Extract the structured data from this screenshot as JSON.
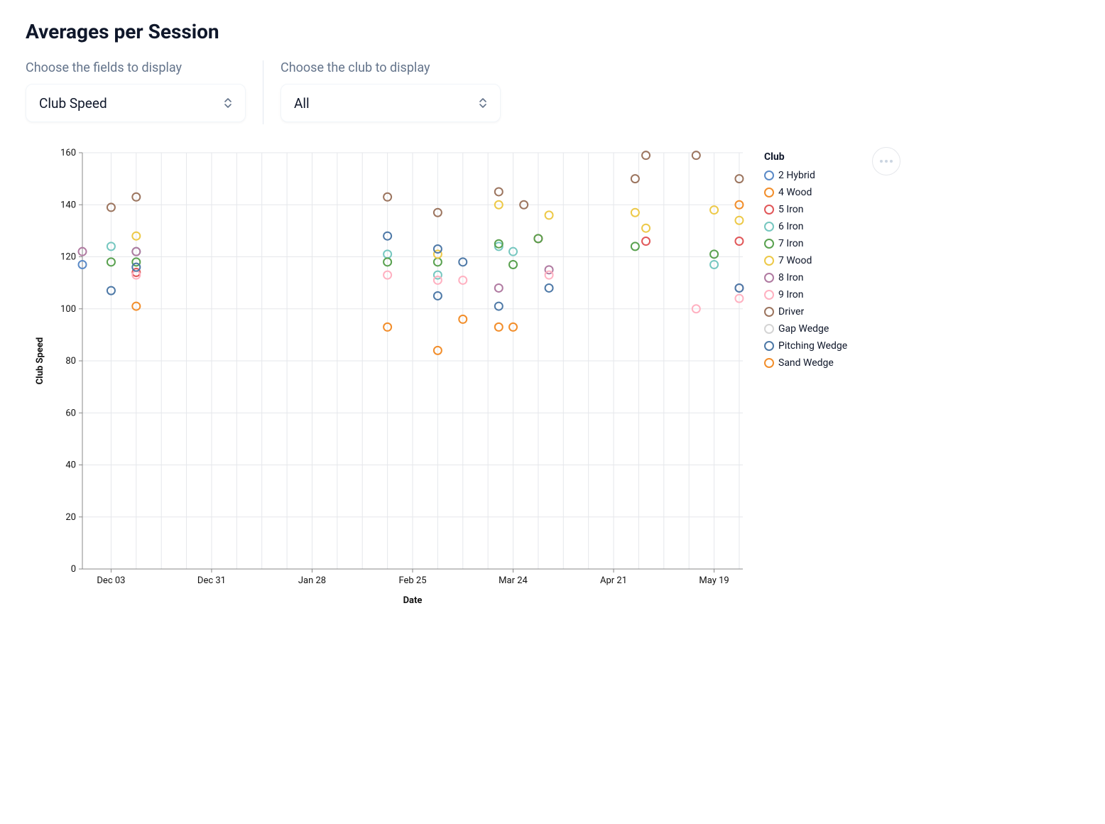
{
  "title": "Averages per Session",
  "controls": {
    "fields_label": "Choose the fields to display",
    "fields_value": "Club Speed",
    "club_label": "Choose the club to display",
    "club_value": "All"
  },
  "chart_data": {
    "type": "scatter",
    "title": "",
    "xlabel": "Date",
    "ylabel": "Club Speed",
    "ylim": [
      0,
      160
    ],
    "y_ticks": [
      0,
      20,
      40,
      60,
      80,
      100,
      120,
      140,
      160
    ],
    "x_ticks": [
      {
        "label": "Dec 03",
        "t": 0
      },
      {
        "label": "Dec 31",
        "t": 28
      },
      {
        "label": "Jan 28",
        "t": 56
      },
      {
        "label": "Feb 25",
        "t": 84
      },
      {
        "label": "Mar 24",
        "t": 112
      },
      {
        "label": "Apr 21",
        "t": 140
      },
      {
        "label": "May 19",
        "t": 168
      }
    ],
    "x_gridlines": [
      0,
      7,
      14,
      21,
      28,
      35,
      42,
      49,
      56,
      63,
      70,
      77,
      84,
      91,
      98,
      105,
      112,
      119,
      126,
      133,
      140,
      147,
      154,
      161,
      168,
      175
    ],
    "x_range": [
      -8,
      176
    ],
    "legend_title": "Club",
    "series": [
      {
        "name": "2 Hybrid",
        "color": "#5b8ac7",
        "points": [
          {
            "t": -8,
            "y": 117
          }
        ]
      },
      {
        "name": "4 Wood",
        "color": "#f28e2b",
        "points": [
          {
            "t": 7,
            "y": 101
          },
          {
            "t": 77,
            "y": 93
          },
          {
            "t": 91,
            "y": 84
          },
          {
            "t": 98,
            "y": 96
          },
          {
            "t": 108,
            "y": 93
          },
          {
            "t": 112,
            "y": 93
          }
        ]
      },
      {
        "name": "5 Iron",
        "color": "#e15759",
        "points": [
          {
            "t": 7,
            "y": 114
          },
          {
            "t": 119,
            "y": 127
          },
          {
            "t": 149,
            "y": 126
          },
          {
            "t": 175,
            "y": 126
          }
        ]
      },
      {
        "name": "6 Iron",
        "color": "#76c7c0",
        "points": [
          {
            "t": 0,
            "y": 124
          },
          {
            "t": 7,
            "y": 122
          },
          {
            "t": 77,
            "y": 121
          },
          {
            "t": 91,
            "y": 113
          },
          {
            "t": 108,
            "y": 124
          },
          {
            "t": 112,
            "y": 122
          },
          {
            "t": 168,
            "y": 117
          }
        ]
      },
      {
        "name": "7 Iron",
        "color": "#59a14f",
        "points": [
          {
            "t": 0,
            "y": 118
          },
          {
            "t": 7,
            "y": 118
          },
          {
            "t": 77,
            "y": 118
          },
          {
            "t": 91,
            "y": 118
          },
          {
            "t": 108,
            "y": 125
          },
          {
            "t": 112,
            "y": 117
          },
          {
            "t": 119,
            "y": 127
          },
          {
            "t": 146,
            "y": 124
          },
          {
            "t": 168,
            "y": 121
          }
        ]
      },
      {
        "name": "7 Wood",
        "color": "#edc948",
        "points": [
          {
            "t": 7,
            "y": 128
          },
          {
            "t": 91,
            "y": 121
          },
          {
            "t": 108,
            "y": 140
          },
          {
            "t": 122,
            "y": 136
          },
          {
            "t": 146,
            "y": 137
          },
          {
            "t": 149,
            "y": 131
          },
          {
            "t": 168,
            "y": 138
          },
          {
            "t": 175,
            "y": 134
          }
        ]
      },
      {
        "name": "8 Iron",
        "color": "#b07aa1",
        "points": [
          {
            "t": -8,
            "y": 122
          },
          {
            "t": 7,
            "y": 122
          },
          {
            "t": 108,
            "y": 108
          },
          {
            "t": 122,
            "y": 115
          },
          {
            "t": 175,
            "y": 108
          }
        ]
      },
      {
        "name": "9 Iron",
        "color": "#ffb1c1",
        "points": [
          {
            "t": 7,
            "y": 113
          },
          {
            "t": 77,
            "y": 113
          },
          {
            "t": 91,
            "y": 111
          },
          {
            "t": 98,
            "y": 111
          },
          {
            "t": 122,
            "y": 113
          },
          {
            "t": 163,
            "y": 100
          },
          {
            "t": 175,
            "y": 104
          }
        ]
      },
      {
        "name": "Driver",
        "color": "#9c755f",
        "points": [
          {
            "t": 0,
            "y": 139
          },
          {
            "t": 7,
            "y": 143
          },
          {
            "t": 77,
            "y": 143
          },
          {
            "t": 91,
            "y": 137
          },
          {
            "t": 108,
            "y": 145
          },
          {
            "t": 115,
            "y": 140
          },
          {
            "t": 146,
            "y": 150
          },
          {
            "t": 149,
            "y": 159
          },
          {
            "t": 163,
            "y": 159
          },
          {
            "t": 175,
            "y": 150
          }
        ]
      },
      {
        "name": "Gap Wedge",
        "color": "#d4d4d4",
        "points": []
      },
      {
        "name": "Pitching Wedge",
        "color": "#4e79a7",
        "points": [
          {
            "t": 0,
            "y": 107
          },
          {
            "t": 7,
            "y": 116
          },
          {
            "t": 77,
            "y": 128
          },
          {
            "t": 91,
            "y": 123
          },
          {
            "t": 91,
            "y": 105
          },
          {
            "t": 98,
            "y": 118
          },
          {
            "t": 108,
            "y": 101
          },
          {
            "t": 122,
            "y": 108
          },
          {
            "t": 175,
            "y": 108
          }
        ]
      },
      {
        "name": "Sand Wedge",
        "color": "#f28e2b",
        "points": [
          {
            "t": 175,
            "y": 140
          }
        ]
      }
    ]
  }
}
